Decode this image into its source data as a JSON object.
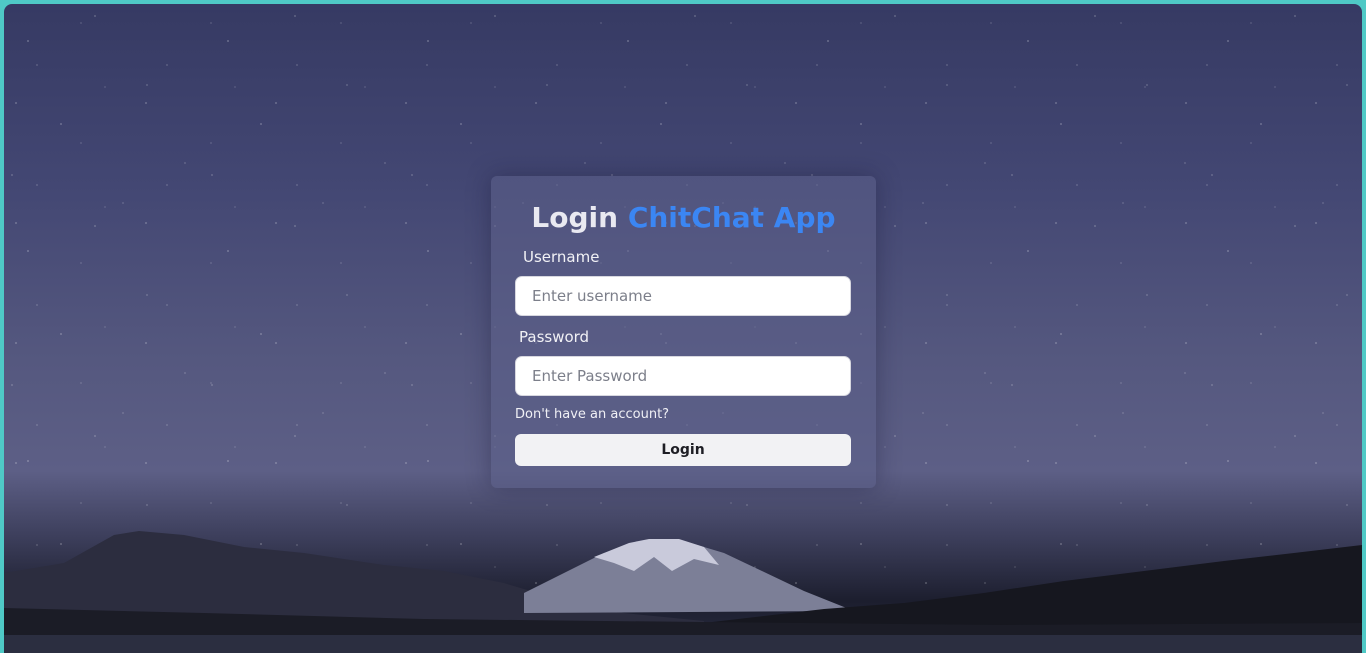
{
  "login": {
    "title_part1": "Login",
    "title_part2": "ChitChat App",
    "username_label": "Username",
    "username_placeholder": "Enter username",
    "password_label": "Password",
    "password_placeholder": "Enter Password",
    "signup_prompt": "Don't have an account?",
    "login_button": "Login"
  },
  "colors": {
    "accent": "#3b86f3",
    "frame_border": "#4fc9c6",
    "card_background": "#5c608a"
  }
}
